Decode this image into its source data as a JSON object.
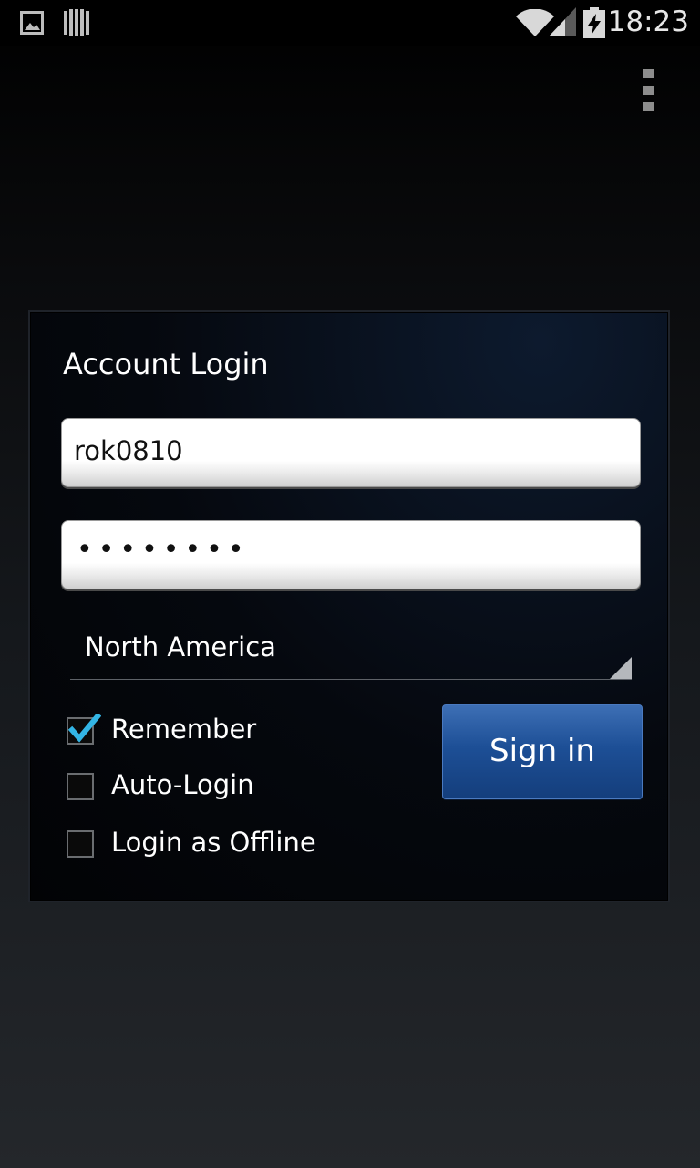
{
  "status_bar": {
    "time": "18:23",
    "icons": [
      "image-notification-icon",
      "barcode-notification-icon",
      "wifi-icon",
      "signal-icon",
      "battery-charging-icon"
    ]
  },
  "action_bar": {
    "menu_icon": "overflow-menu-icon"
  },
  "login_panel": {
    "title": "Account Login",
    "username_value": "rok0810",
    "password_mask": "••••••••",
    "region_selected": "North America",
    "remember_label": "Remember",
    "remember_checked": true,
    "auto_login_label": "Auto-Login",
    "auto_login_checked": false,
    "offline_label": "Login as Offline",
    "offline_checked": false,
    "sign_in_label": "Sign in"
  },
  "colors": {
    "accent_check": "#33b5e5",
    "button_blue": "#1d4f96"
  }
}
